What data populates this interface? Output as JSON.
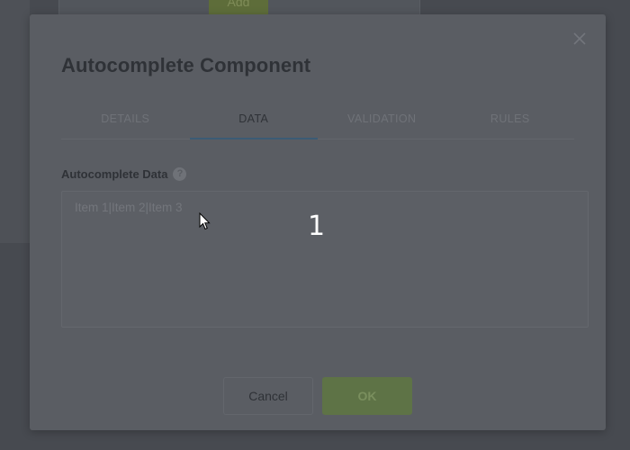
{
  "background": {
    "add_button_label": "Add"
  },
  "modal": {
    "title": "Autocomplete Component",
    "close_icon": "close-icon",
    "tabs": [
      {
        "label": "DETAILS",
        "active": false
      },
      {
        "label": "DATA",
        "active": true
      },
      {
        "label": "VALIDATION",
        "active": false
      },
      {
        "label": "RULES",
        "active": false
      }
    ],
    "field": {
      "label": "Autocomplete Data",
      "help_icon": "question-mark-icon",
      "help_glyph": "?",
      "placeholder": "Item 1|Item 2|Item 3",
      "value": ""
    },
    "step_marker": "1",
    "buttons": {
      "cancel_label": "Cancel",
      "ok_label": "OK"
    }
  },
  "colors": {
    "accent_tab_underline": "#3b5b75",
    "ok_button": "#5e7346",
    "overlay_background": "#4a4d53",
    "modal_background": "#5a5d63"
  }
}
